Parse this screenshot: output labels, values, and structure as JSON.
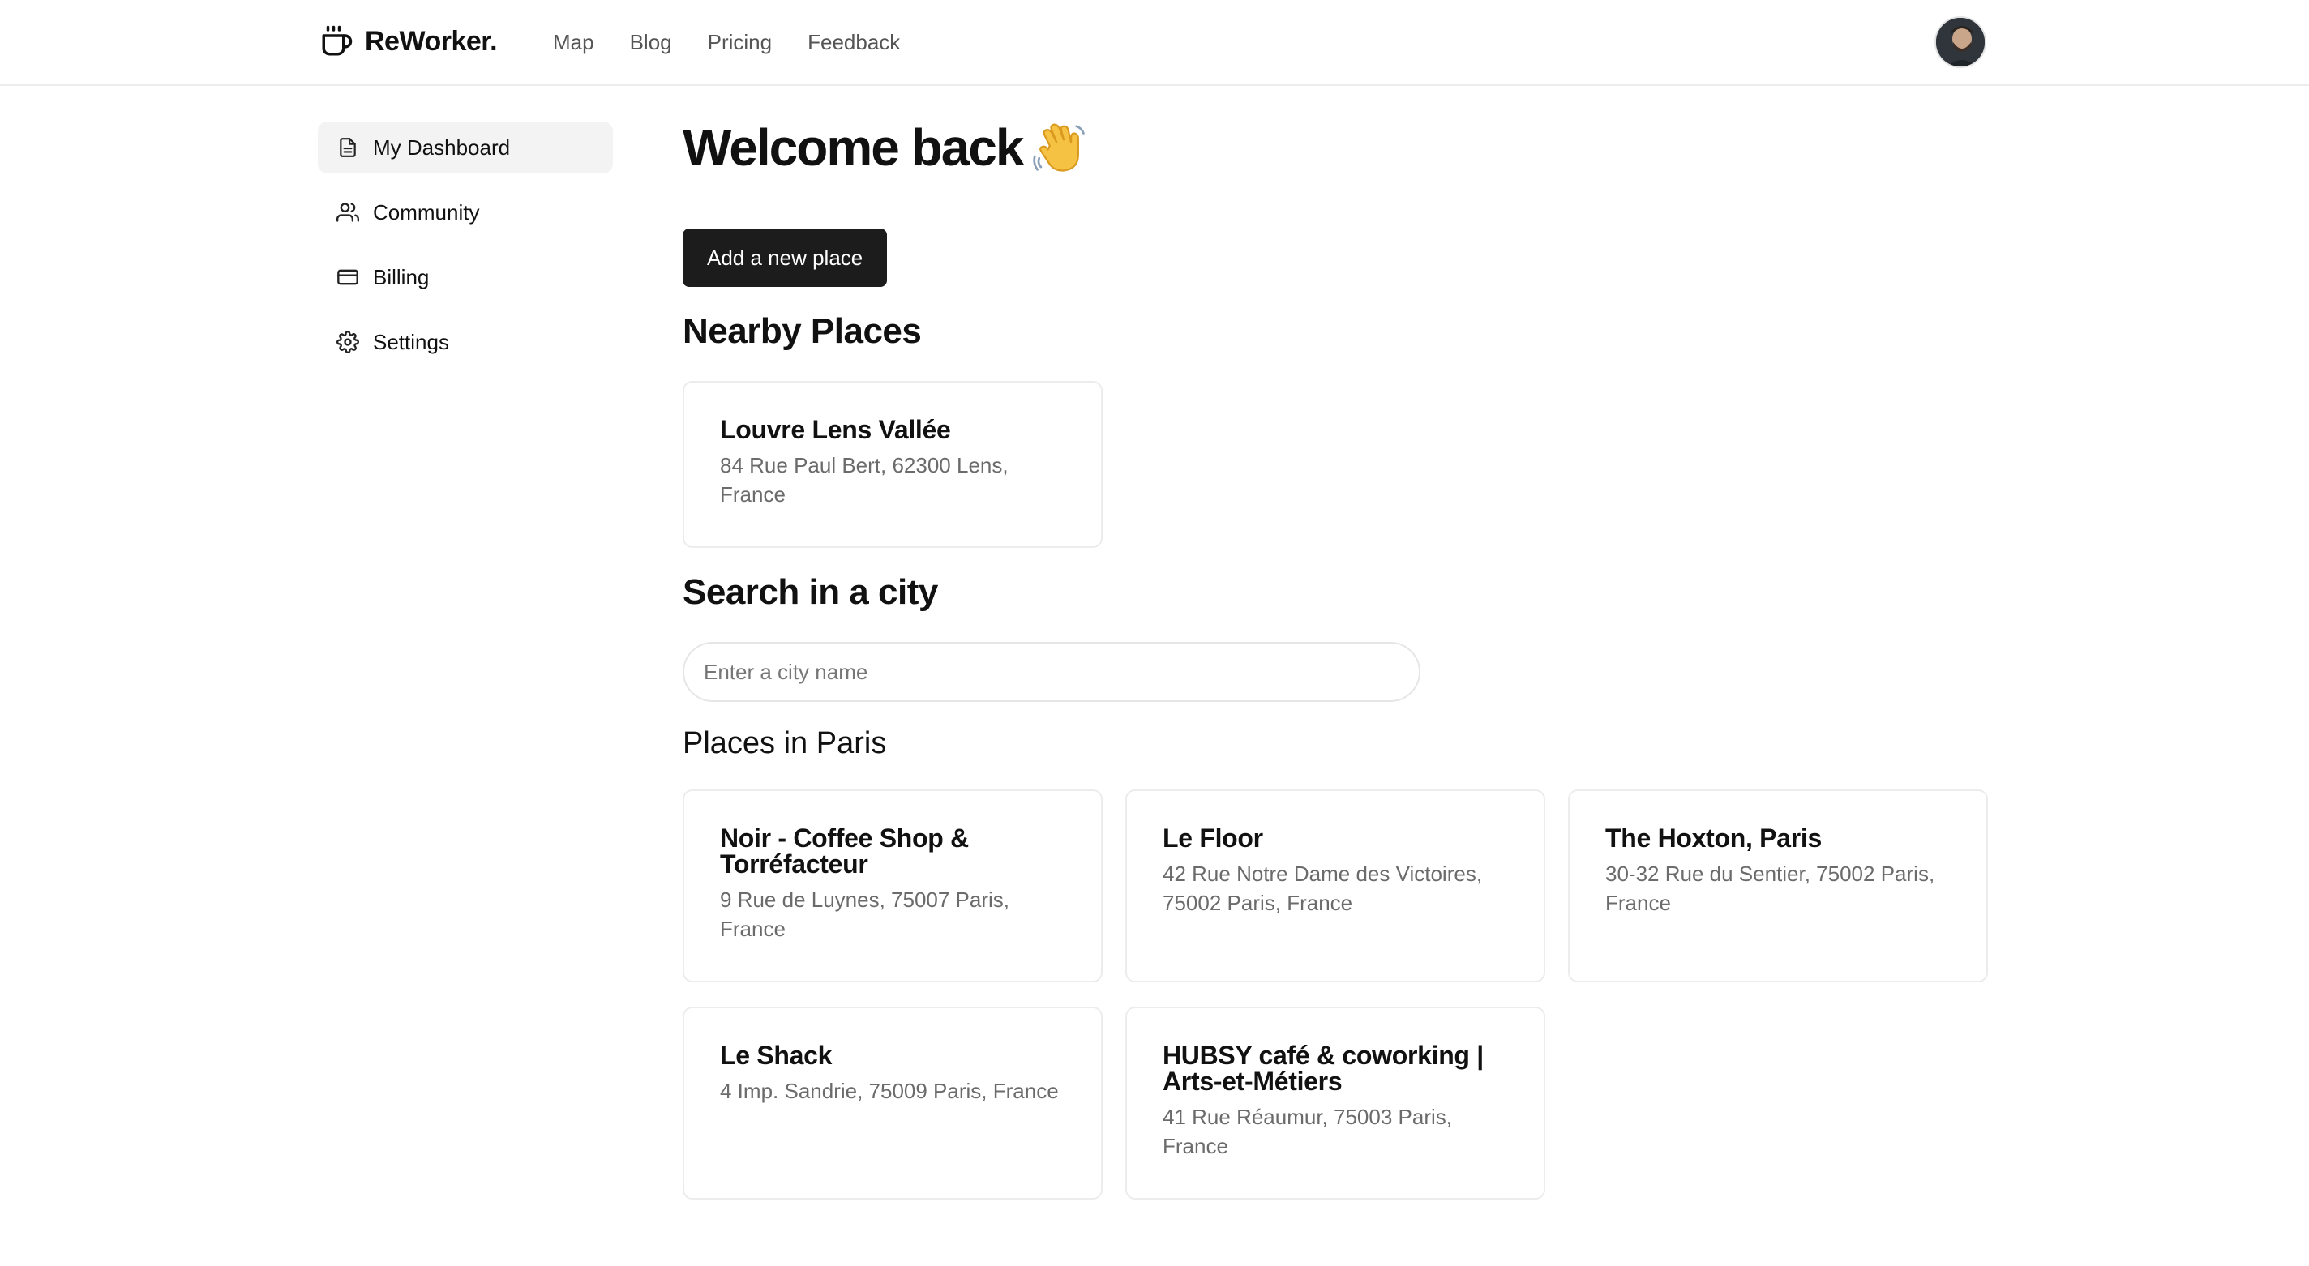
{
  "app": {
    "name": "ReWorker."
  },
  "nav": [
    {
      "label": "Map"
    },
    {
      "label": "Blog"
    },
    {
      "label": "Pricing"
    },
    {
      "label": "Feedback"
    }
  ],
  "sidebar": {
    "items": [
      {
        "label": "My Dashboard",
        "icon": "document-icon",
        "active": true
      },
      {
        "label": "Community",
        "icon": "users-icon",
        "active": false
      },
      {
        "label": "Billing",
        "icon": "credit-card-icon",
        "active": false
      },
      {
        "label": "Settings",
        "icon": "gear-icon",
        "active": false
      }
    ]
  },
  "main": {
    "welcome": "Welcome back",
    "add_place_label": "Add a new place",
    "nearby_title": "Nearby Places",
    "nearby": [
      {
        "name": "Louvre Lens Vallée",
        "address": "84 Rue Paul Bert, 62300 Lens, France"
      }
    ],
    "search_title": "Search in a city",
    "search_placeholder": "Enter a city name",
    "search_value": "",
    "city_results_title": "Places in Paris",
    "city_places": [
      {
        "name": "Noir - Coffee Shop & Torréfacteur",
        "address": "9 Rue de Luynes, 75007 Paris, France"
      },
      {
        "name": "Le Floor",
        "address": "42 Rue Notre Dame des Victoires, 75002 Paris, France"
      },
      {
        "name": "The Hoxton, Paris",
        "address": "30-32 Rue du Sentier, 75002 Paris, France"
      },
      {
        "name": "Le Shack",
        "address": "4 Imp. Sandrie, 75009 Paris, France"
      },
      {
        "name": "HUBSY café & coworking | Arts-et-Métiers",
        "address": "41 Rue Réaumur, 75003 Paris, France"
      }
    ]
  },
  "colors": {
    "primary_button": "#1c1c1c",
    "active_sidebar_bg": "#f3f3f3",
    "border": "#ececec",
    "muted_text": "#6b6b6b"
  }
}
